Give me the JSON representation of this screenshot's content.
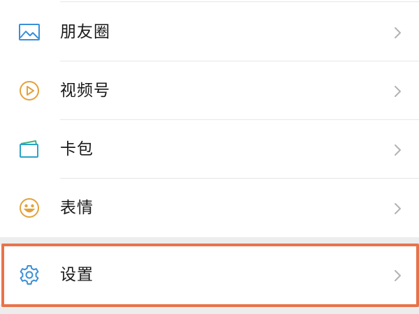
{
  "menu": {
    "items": [
      {
        "label": "朋友圈",
        "icon": "moments-image-icon",
        "color": "#3a8fd6"
      },
      {
        "label": "视频号",
        "icon": "channels-play-icon",
        "color": "#e3a23b"
      },
      {
        "label": "卡包",
        "icon": "card-wallet-icon",
        "color": "#2aa3c9"
      },
      {
        "label": "表情",
        "icon": "sticker-smile-icon",
        "color": "#e3a23b"
      }
    ],
    "settings": {
      "label": "设置",
      "icon": "gear-icon",
      "color": "#3a8fd6"
    }
  },
  "colors": {
    "background": "#ededed",
    "row": "#ffffff",
    "text": "#191919",
    "chevron": "#b2b2b2",
    "divider": "#e6e6e6",
    "highlight": "#e8734a"
  }
}
